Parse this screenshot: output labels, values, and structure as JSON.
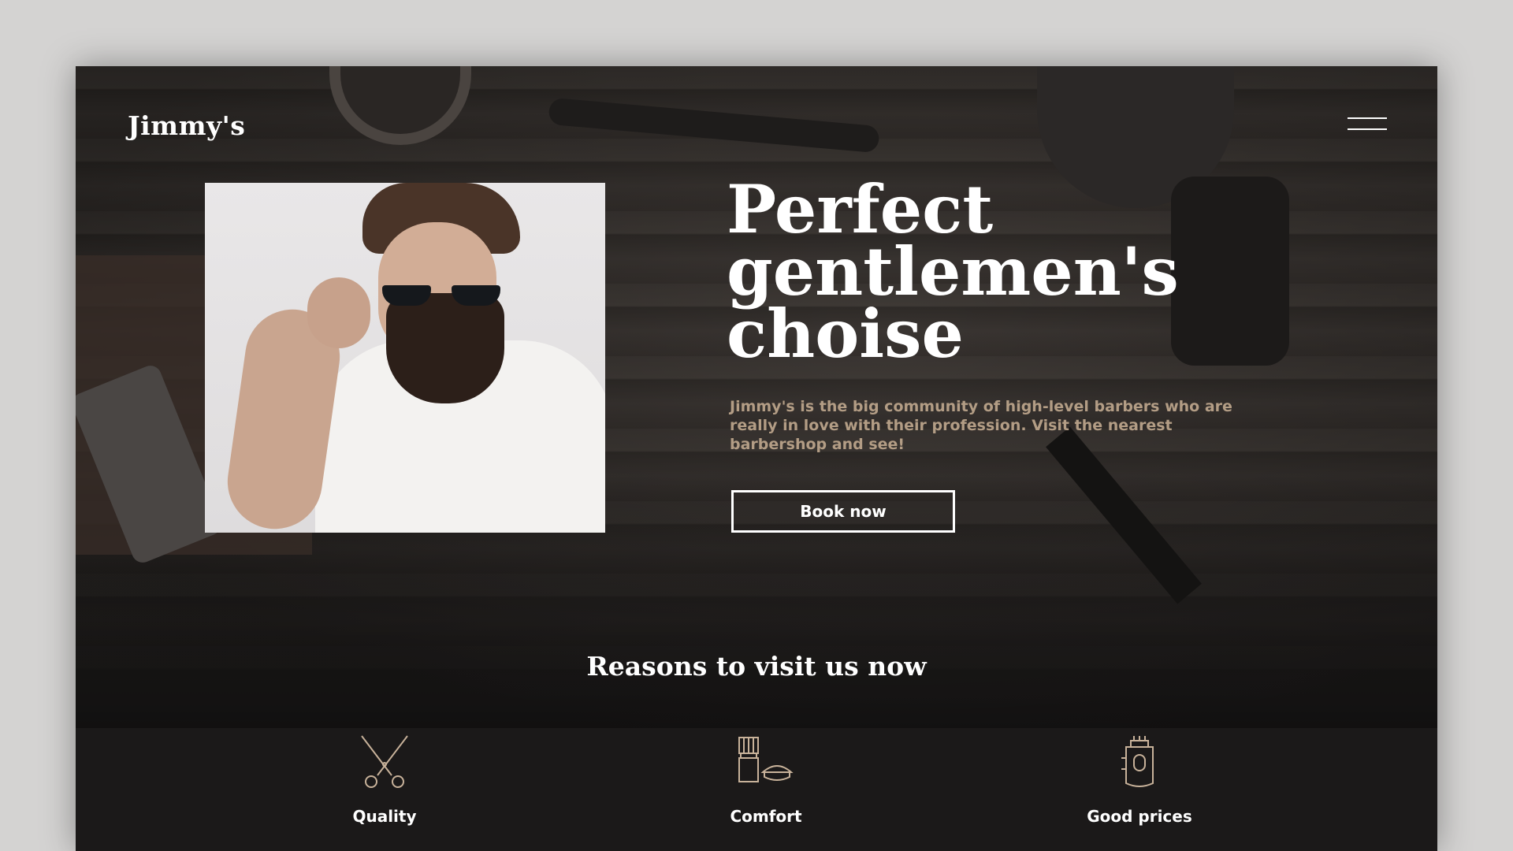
{
  "brand": {
    "logo": "Jimmy's"
  },
  "nav": {
    "menu_icon": "hamburger-menu-icon"
  },
  "hero": {
    "title_lines": [
      "Perfect",
      "gentlemen's",
      "choise"
    ],
    "description": "Jimmy's is the big community of high-level barbers who are really in love with their profession. Visit the nearest barbershop and see!",
    "cta_label": "Book now",
    "photo": "bearded-man-with-sunglasses-photo"
  },
  "reasons": {
    "title": "Reasons to visit us now",
    "items": [
      {
        "label": "Quality",
        "icon": "scissors-icon"
      },
      {
        "label": "Comfort",
        "icon": "shaving-brush-icon"
      },
      {
        "label": "Good prices",
        "icon": "hair-clipper-icon"
      }
    ]
  },
  "colors": {
    "background": "#1b1919",
    "accent_text": "#b39d85",
    "icon_stroke": "#c8b29a",
    "white": "#ffffff"
  }
}
